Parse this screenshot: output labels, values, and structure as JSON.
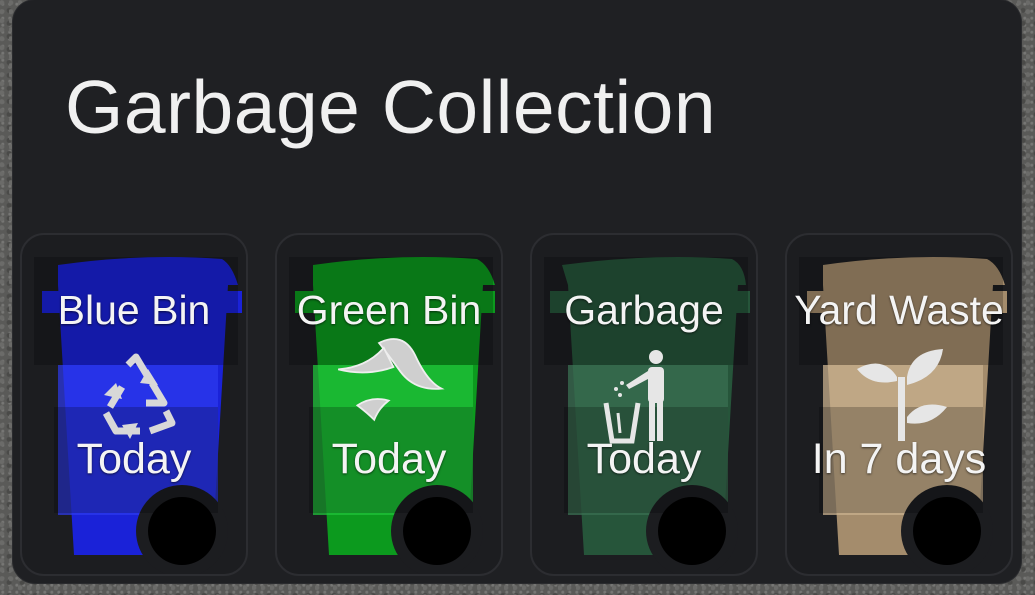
{
  "card": {
    "title": "Garbage Collection"
  },
  "bins": [
    {
      "name": "Blue Bin",
      "when": "Today",
      "color": "#1a22d8",
      "light": "#2e3af0",
      "icon": "recycle-icon"
    },
    {
      "name": "Green Bin",
      "when": "Today",
      "color": "#0c9a1e",
      "light": "#1fc13a",
      "icon": "banana-peel-icon"
    },
    {
      "name": "Garbage",
      "when": "Today",
      "color": "#26553a",
      "light": "#3a6f52",
      "icon": "person-trash-icon"
    },
    {
      "name": "Yard Waste",
      "when": "In 7 days",
      "color": "#a48c6c",
      "light": "#c8b08e",
      "icon": "sprout-icon"
    }
  ]
}
